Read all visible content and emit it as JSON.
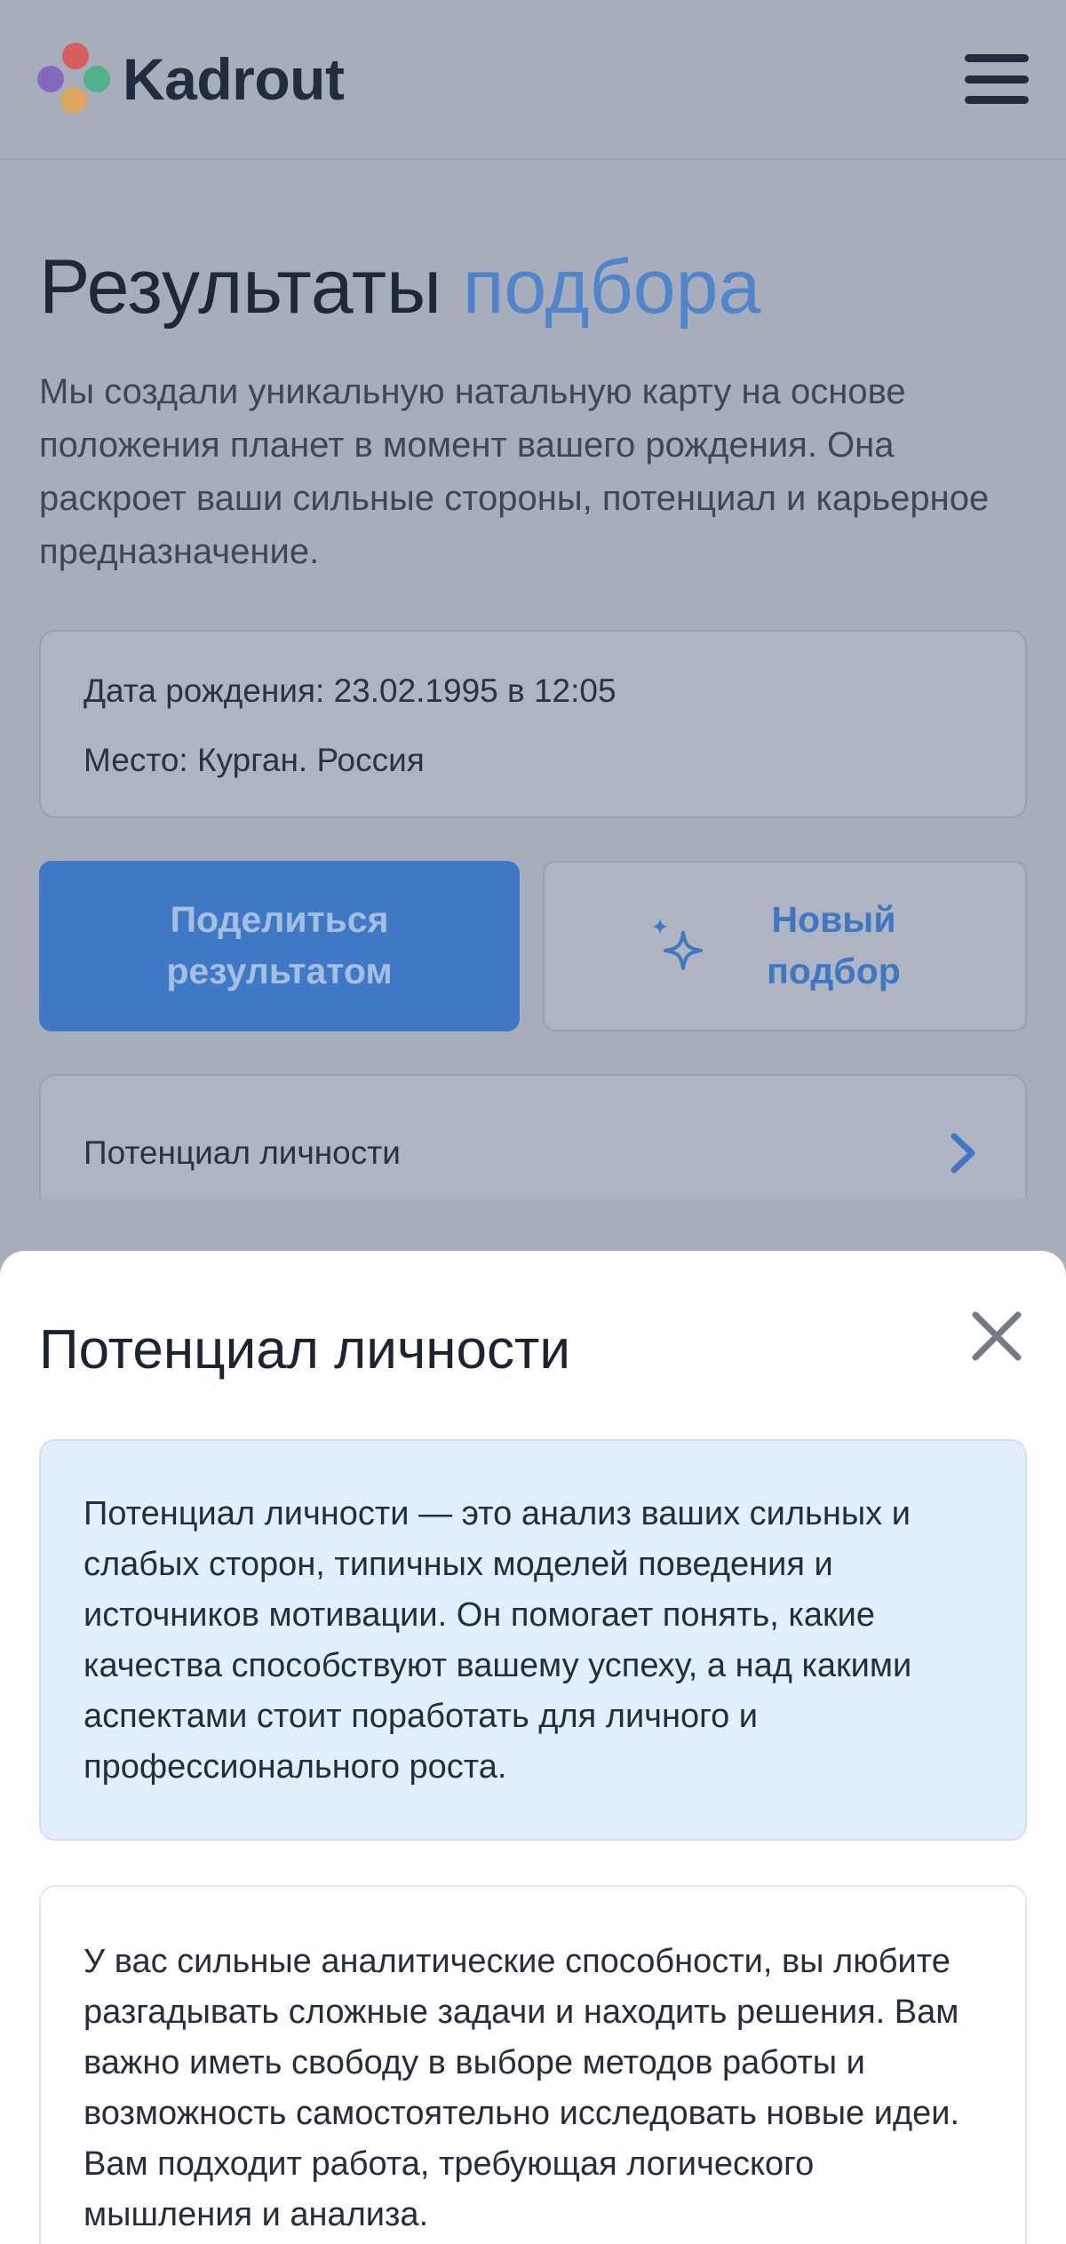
{
  "header": {
    "brand": "Kadrout",
    "logo_colors": [
      "#e8413b",
      "#7a4fc0",
      "#2fb37a",
      "#f2a53a"
    ]
  },
  "main": {
    "title_main": "Результаты",
    "title_accent": "подбора",
    "description": "Мы создали уникальную натальную карту на основе положения планет в момент вашего рождения. Она раскроет ваши сильные стороны, потенциал и карьерное предназначение.",
    "birth_date": "Дата рождения: 23.02.1995 в 12:05",
    "birth_place": "Место: Курган. Россия",
    "share_button": "Поделиться результатом",
    "new_button": "Новый подбор",
    "section_label": "Потенциал личности"
  },
  "sheet": {
    "title": "Потенциал личности",
    "note": "Потенциал личности  — это анализ ваших сильных и слабых сторон, типичных моделей поведения и источников мотивации. Он помогает понять, какие качества способствуют вашему успеху, а над какими аспектами стоит поработать для личного и профессионального роста.",
    "content": "У вас сильные аналитические способности, вы любите разгадывать сложные задачи и находить решения. Вам важно иметь свободу в выборе методов работы и возможность самостоятельно исследовать новые идеи. Вам подходит работа, требующая логического мышления и анализа."
  },
  "colors": {
    "accent": "#4f85cc",
    "primary_button": "#3f79c5",
    "note_background": "#e3eefc"
  }
}
